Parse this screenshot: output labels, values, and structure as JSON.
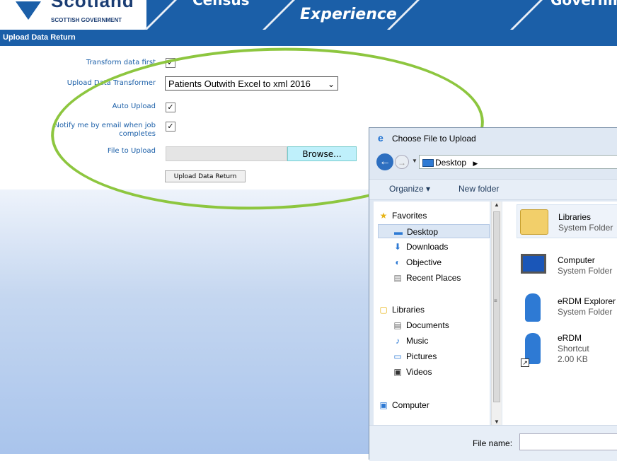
{
  "banner": {
    "logo_word": "Scotland",
    "logo_sub": "SCOTTISH GOVERNMENT",
    "items": [
      "Census",
      "Experience",
      "Government"
    ]
  },
  "titlebar": {
    "title": "Upload Data Return"
  },
  "form": {
    "transform_label": "Transform data first",
    "transformer_label": "Upload Data Transformer",
    "transformer_value": "Patients Outwith Excel to xml 2016",
    "auto_upload_label": "Auto Upload",
    "notify_label": "Notify me by email when job completes",
    "file_label": "File to Upload",
    "browse_label": "Browse...",
    "upload_button": "Upload Data Return",
    "check": "✓"
  },
  "dialog": {
    "title": "Choose File to Upload",
    "address": "Desktop",
    "organize": "Organize ▾",
    "new_folder": "New folder",
    "nav": {
      "favorites": "Favorites",
      "desktop": "Desktop",
      "downloads": "Downloads",
      "objective": "Objective",
      "recent": "Recent Places",
      "libraries": "Libraries",
      "documents": "Documents",
      "music": "Music",
      "pictures": "Pictures",
      "videos": "Videos",
      "computer": "Computer"
    },
    "files": [
      {
        "name": "Libraries",
        "type": "System Folder"
      },
      {
        "name": "Computer",
        "type": "System Folder"
      },
      {
        "name": "eRDM Explorer",
        "type": "System Folder"
      },
      {
        "name": "eRDM",
        "type": "Shortcut",
        "size": "2.00 KB"
      }
    ],
    "file_name_label": "File name:"
  },
  "colors": {
    "banner": "#1b5fa8",
    "highlight_ellipse": "#8dc63f",
    "browse": "#bff0fb"
  }
}
